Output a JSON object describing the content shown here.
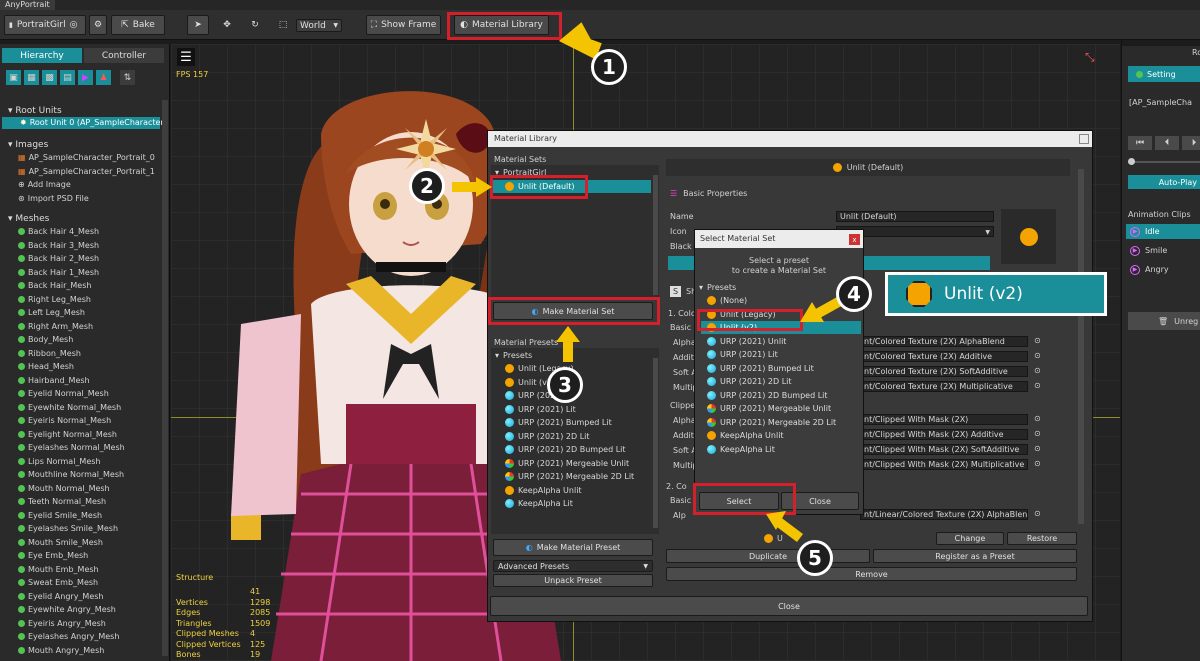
{
  "app": {
    "title": "AnyPortrait"
  },
  "toolbar": {
    "portrait": "PortraitGirl",
    "bake": "Bake",
    "space": "World",
    "show_frame": "Show Frame",
    "material_library": "Material Library"
  },
  "left": {
    "tabs": [
      "Hierarchy",
      "Controller"
    ],
    "root_units_title": "Root Units",
    "root_unit": "Root Unit 0 (AP_SampleCharacter_",
    "images_title": "Images",
    "images": [
      "AP_SampleCharacter_Portrait_0",
      "AP_SampleCharacter_Portrait_1",
      "Add Image",
      "Import PSD File"
    ],
    "meshes_title": "Meshes",
    "meshes": [
      "Back Hair 4_Mesh",
      "Back Hair 3_Mesh",
      "Back Hair 2_Mesh",
      "Back Hair 1_Mesh",
      "Back Hair_Mesh",
      "Right Leg_Mesh",
      "Left Leg_Mesh",
      "Right Arm_Mesh",
      "Body_Mesh",
      "Ribbon_Mesh",
      "Head_Mesh",
      "Hairband_Mesh",
      "Eyelid Normal_Mesh",
      "Eyewhite Normal_Mesh",
      "Eyeiris Normal_Mesh",
      "Eyelight Normal_Mesh",
      "Eyelashes Normal_Mesh",
      "Lips Normal_Mesh",
      "Mouthline Normal_Mesh",
      "Mouth Normal_Mesh",
      "Teeth Normal_Mesh",
      "Eyelid Smile_Mesh",
      "Eyelashes Smile_Mesh",
      "Mouth Smile_Mesh",
      "Eye Emb_Mesh",
      "Mouth Emb_Mesh",
      "Sweat Emb_Mesh",
      "Eyelid Angry_Mesh",
      "Eyewhite Angry_Mesh",
      "Eyeiris Angry_Mesh",
      "Eyelashes Angry_Mesh",
      "Mouth Angry_Mesh"
    ]
  },
  "viewport": {
    "fps": "FPS 157",
    "stats": [
      {
        "label": "Structure",
        "value": ""
      },
      {
        "label": "Vertices",
        "value": "1298"
      },
      {
        "label": "Edges",
        "value": "2085"
      },
      {
        "label": "Triangles",
        "value": "1509"
      },
      {
        "label": "Clipped Meshes",
        "value": "4"
      },
      {
        "label": "Clipped Vertices",
        "value": "125"
      },
      {
        "label": "Bones",
        "value": "19"
      }
    ],
    "stat_top_value": "41"
  },
  "right": {
    "tab": "Ro",
    "setting": "Setting",
    "name": "[AP_SampleCha",
    "autoplay": "Auto-Play",
    "clips_title": "Animation Clips",
    "clips": [
      "Idle",
      "Smile",
      "Angry"
    ],
    "unreg": "Unreg"
  },
  "matlib": {
    "title": "Material Library",
    "sets_title": "Material Sets",
    "set_group": "PortraitGirl",
    "set_item": "Unlit (Default)",
    "make_set": "Make Material Set",
    "presets_title": "Material Presets",
    "presets_group": "Presets",
    "presets": [
      {
        "name": "Unlit (Legacy)",
        "icon": "orange"
      },
      {
        "name": "Unlit (v2)",
        "icon": "orange"
      },
      {
        "name": "URP (2021)",
        "icon": "cyan"
      },
      {
        "name": "URP (2021) Lit",
        "icon": "cyan"
      },
      {
        "name": "URP (2021) Bumped Lit",
        "icon": "cyan"
      },
      {
        "name": "URP (2021) 2D Lit",
        "icon": "cyan"
      },
      {
        "name": "URP (2021) 2D Bumped Lit",
        "icon": "cyan"
      },
      {
        "name": "URP (2021) Mergeable Unlit",
        "icon": "multi"
      },
      {
        "name": "URP (2021) Mergeable 2D Lit",
        "icon": "multi"
      },
      {
        "name": "KeepAlpha Unlit",
        "icon": "orange"
      },
      {
        "name": "KeepAlpha Lit",
        "icon": "cyan"
      }
    ],
    "make_preset": "Make Material Preset",
    "advanced": "Advanced Presets",
    "unpack": "Unpack Preset",
    "header": "Unlit (Default)",
    "basic_props": "Basic Properties",
    "name_label": "Name",
    "name_value": "Unlit (Default)",
    "icon_label": "Icon",
    "black_label": "Black",
    "shader_label": "Sh",
    "section1": "1. Color",
    "basic_p": "Basic P",
    "rows1": [
      {
        "label": "Alpha",
        "value": "nt/Colored Texture (2X) AlphaBlend"
      },
      {
        "label": "Additi",
        "value": "nt/Colored Texture (2X) Additive"
      },
      {
        "label": "Soft A",
        "value": "nt/Colored Texture (2X) SoftAdditive"
      },
      {
        "label": "Multip",
        "value": "nt/Colored Texture (2X) Multiplicative"
      }
    ],
    "clipped": "Clipped",
    "rows2": [
      {
        "label": "Alpha",
        "value": "nt/Clipped With Mask (2X)"
      },
      {
        "label": "Additi",
        "value": "nt/Clipped With Mask (2X) Additive"
      },
      {
        "label": "Soft A",
        "value": "nt/Clipped With Mask (2X) SoftAdditive"
      },
      {
        "label": "Multip",
        "value": "nt/Clipped With Mask (2X) Multiplicative"
      }
    ],
    "section2": "2. Co",
    "basic_p2": "Basic P",
    "alp": "Alp",
    "row3": "nt/Linear/Colored Texture (2X) AlphaBlend",
    "under_label": "U",
    "change": "Change",
    "restore": "Restore",
    "duplicate": "Duplicate",
    "register": "Register as a Preset",
    "remove": "Remove",
    "close": "Close"
  },
  "select": {
    "title": "Select Material Set",
    "close_x": "x",
    "desc1": "Select a preset",
    "desc2": "to create a Material Set",
    "group": "Presets",
    "items": [
      {
        "name": "(None)",
        "icon": "orange"
      },
      {
        "name": "Unlit (Legacy)",
        "icon": "orange"
      },
      {
        "name": "Unlit (v2)",
        "icon": "orange"
      },
      {
        "name": "URP (2021) Unlit",
        "icon": "cyan"
      },
      {
        "name": "URP (2021) Lit",
        "icon": "cyan"
      },
      {
        "name": "URP (2021) Bumped Lit",
        "icon": "cyan"
      },
      {
        "name": "URP (2021) 2D Lit",
        "icon": "cyan"
      },
      {
        "name": "URP (2021) 2D Bumped Lit",
        "icon": "cyan"
      },
      {
        "name": "URP (2021) Mergeable Unlit",
        "icon": "multi"
      },
      {
        "name": "URP (2021) Mergeable 2D Lit",
        "icon": "multi"
      },
      {
        "name": "KeepAlpha Unlit",
        "icon": "orange"
      },
      {
        "name": "KeepAlpha Lit",
        "icon": "cyan"
      }
    ],
    "select_btn": "Select",
    "close_btn": "Close"
  },
  "zoom_label": "Unlit (v2)",
  "callouts": [
    "1",
    "2",
    "3",
    "4",
    "5"
  ],
  "colors": {
    "accent": "#1a8f99",
    "red": "#d3202a",
    "arrow": "#f5c400",
    "orange": "#f4a300"
  }
}
